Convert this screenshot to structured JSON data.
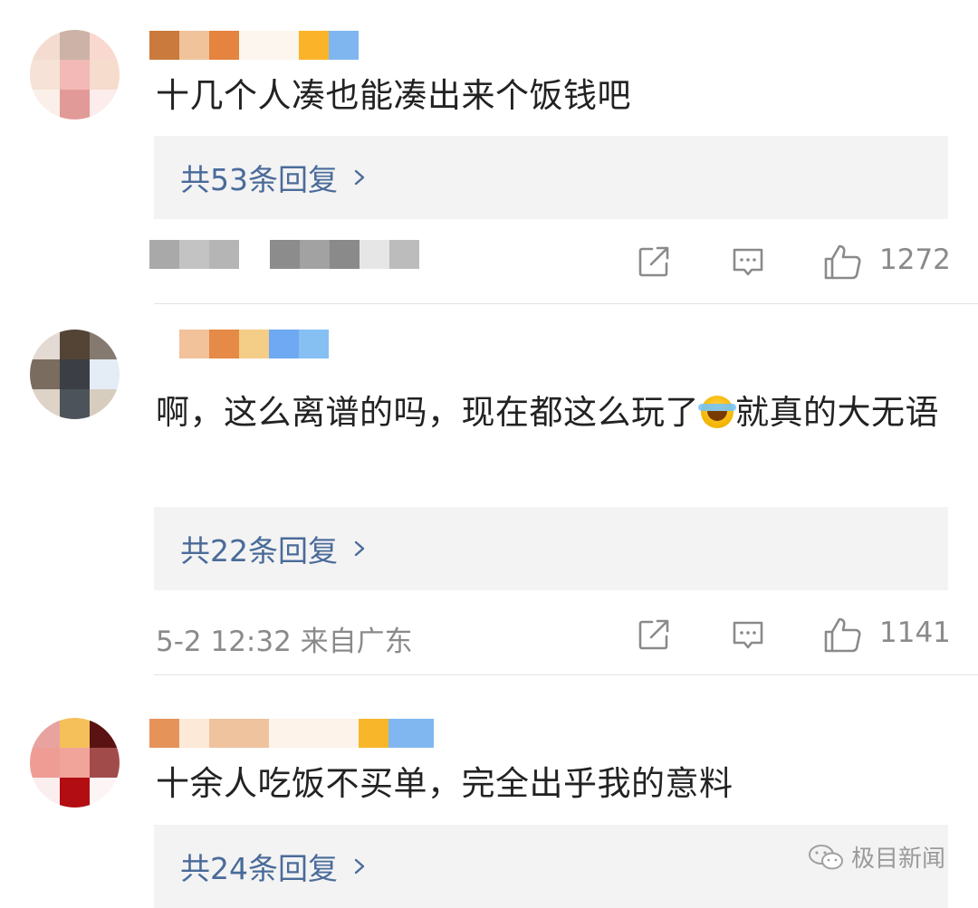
{
  "comments": [
    {
      "text": "十几个人凑也能凑出来个饭钱吧",
      "reply_summary": "共53条回复",
      "meta": "",
      "like_count": "1272"
    },
    {
      "text": "啊，这么离谱的吗，现在都这么玩了",
      "text_after_emoji": "就真的大无语",
      "emoji": "cry-laugh-emoji",
      "reply_summary": "共22条回复",
      "meta": "5-2 12:32 来自广东",
      "like_count": "1141"
    },
    {
      "text": "十余人吃饭不买单，完全出乎我的意料",
      "reply_summary": "共24条回复"
    }
  ],
  "icons": {
    "share": "share-icon",
    "comment": "comment-icon",
    "like": "thumbs-up-icon",
    "reply_chevron": "chevron-right-icon"
  },
  "watermark": {
    "text": "极目新闻",
    "icon": "wechat-icon"
  },
  "colors": {
    "reply_link": "#4a6b9a",
    "meta_gray": "#8a8a8a",
    "reply_bg": "#f3f3f3"
  }
}
